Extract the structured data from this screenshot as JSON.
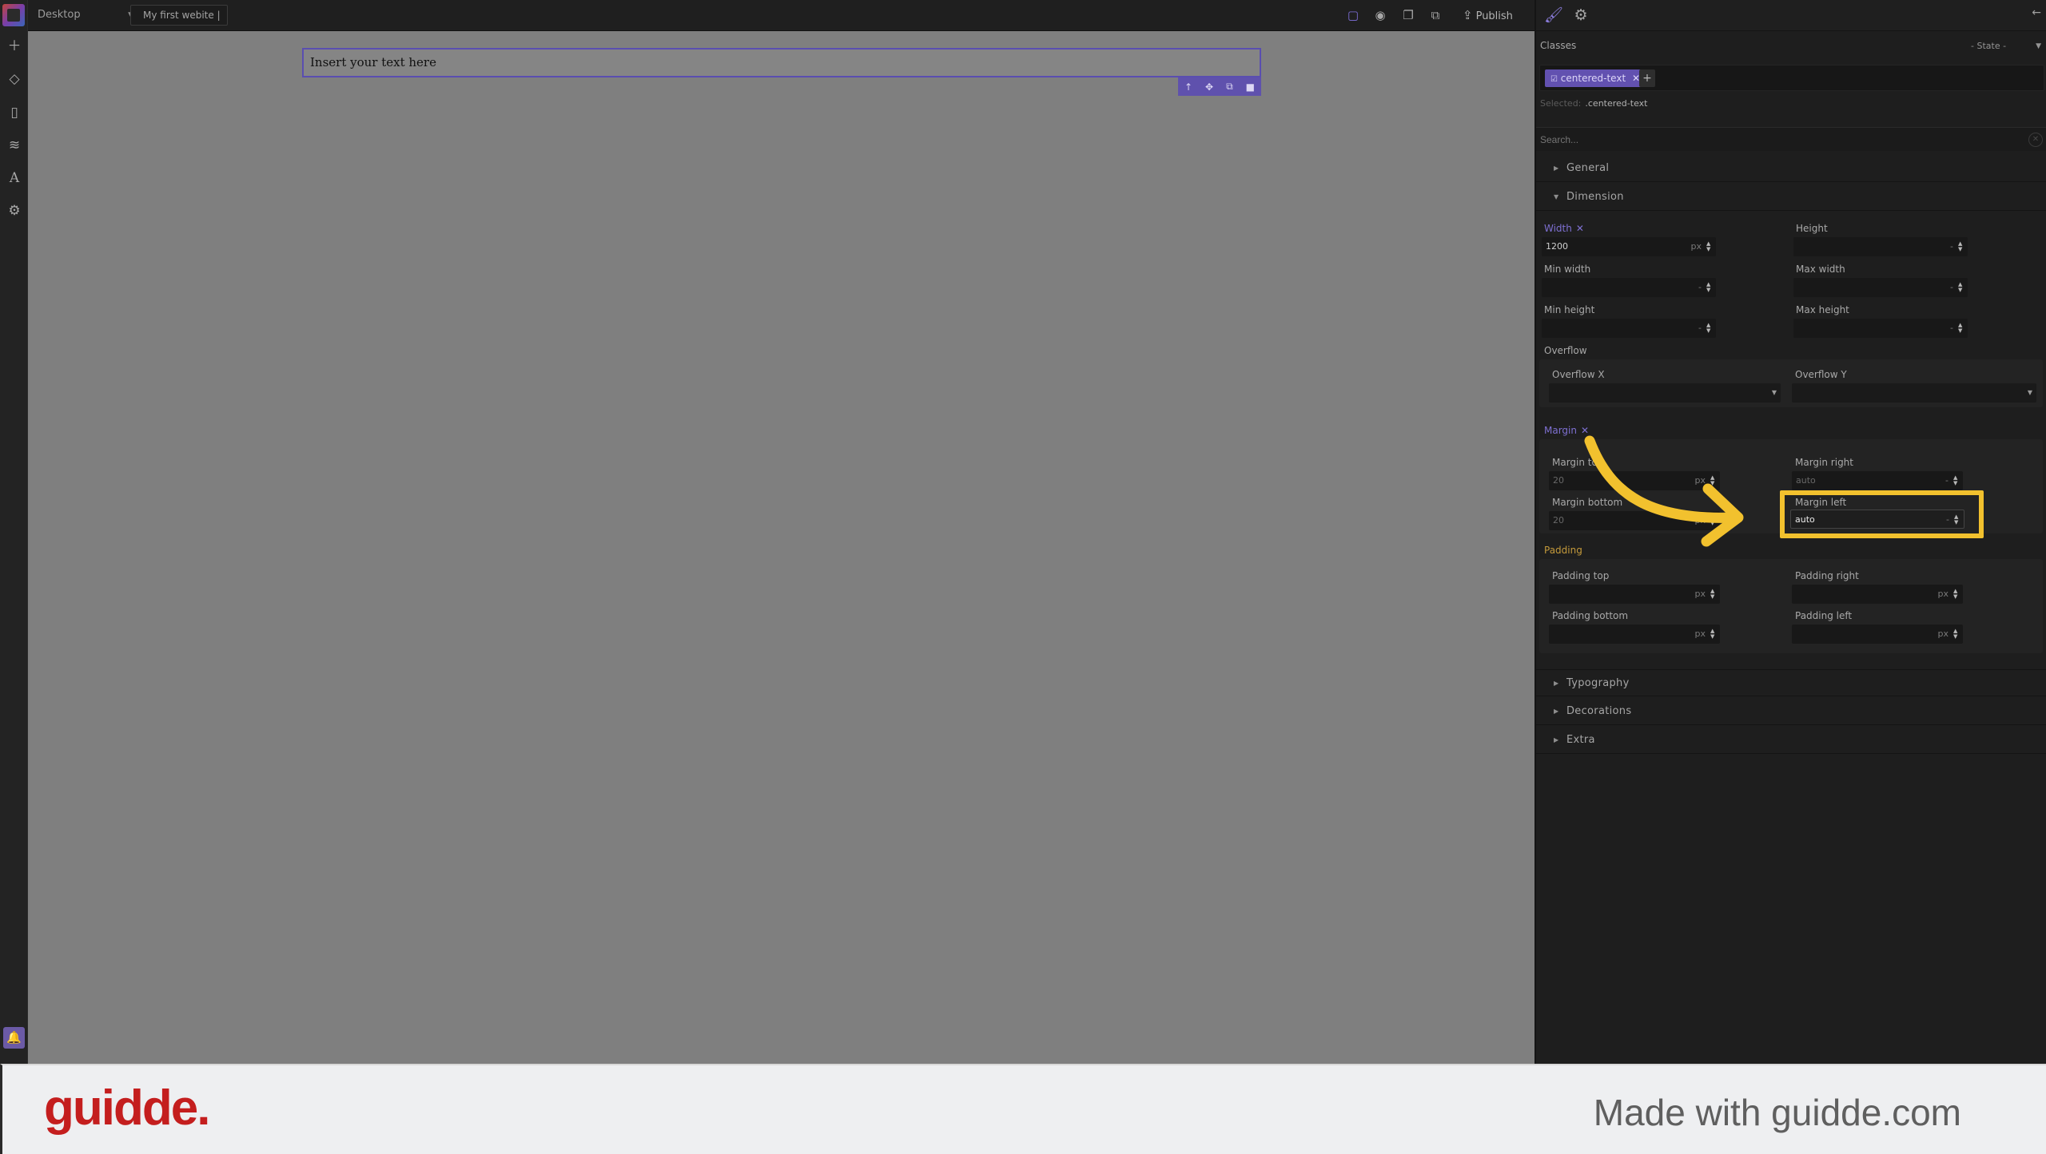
{
  "topbar": {
    "device": "Desktop",
    "site_name": "My first webite |",
    "publish_label": "Publish"
  },
  "canvas": {
    "text_block": "Insert your text here"
  },
  "panel": {
    "classes_label": "Classes",
    "state_label": "- State -",
    "class_tag": "centered-text",
    "selected_label": "Selected:",
    "selected_value": ".centered-text",
    "search_placeholder": "Search...",
    "sectors": {
      "general": "General",
      "dimension": "Dimension",
      "typography": "Typography",
      "decorations": "Decorations",
      "extra": "Extra"
    },
    "dimension": {
      "width_label": "Width",
      "width_value": "1200",
      "width_unit": "px",
      "height_label": "Height",
      "min_width_label": "Min width",
      "max_width_label": "Max width",
      "min_height_label": "Min height",
      "max_height_label": "Max height",
      "dash": "-",
      "overflow_label": "Overflow",
      "overflow_x_label": "Overflow X",
      "overflow_y_label": "Overflow Y",
      "margin_label": "Margin",
      "margin_top_label": "Margin top",
      "margin_top_value": "20",
      "margin_right_label": "Margin right",
      "margin_right_value": "auto",
      "margin_bottom_label": "Margin bottom",
      "margin_bottom_value": "20",
      "margin_left_label": "Margin left",
      "margin_left_value": "auto",
      "unit_px": "px",
      "padding_label": "Padding",
      "padding_top_label": "Padding top",
      "padding_right_label": "Padding right",
      "padding_bottom_label": "Padding bottom",
      "padding_left_label": "Padding left"
    }
  },
  "annotation": {
    "highlight_color": "#f2c12e"
  },
  "footer": {
    "brand": "guidde.",
    "made_with": "Made with guidde.com"
  },
  "colors": {
    "accent": "#6251b0",
    "canvas": "#7f7f7f",
    "brand_red": "#c41e1e"
  }
}
